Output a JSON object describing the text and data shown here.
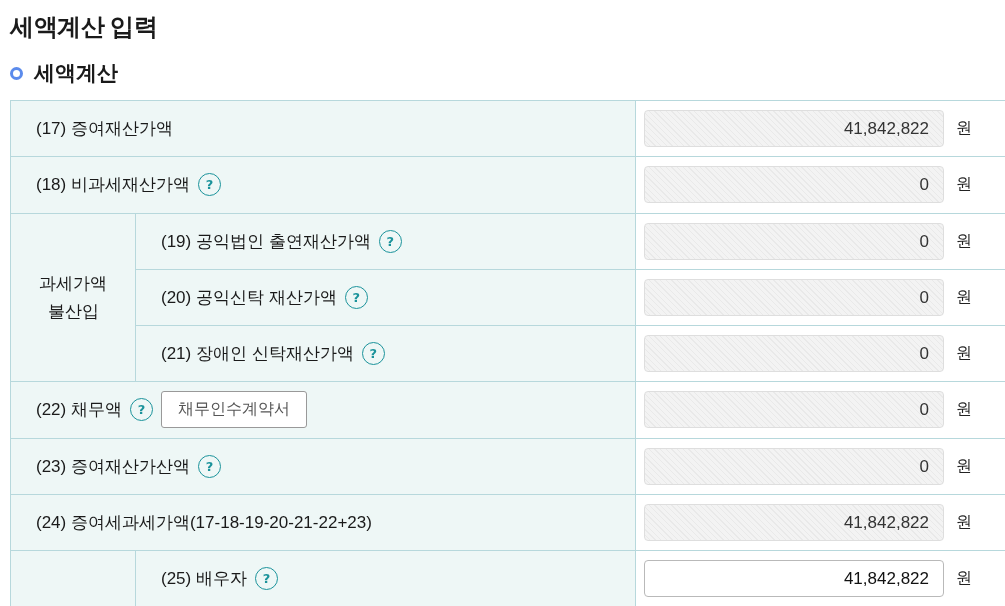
{
  "page_title": "세액계산 입력",
  "section": {
    "title": "세액계산"
  },
  "rows": [
    {
      "kind": "single",
      "label": "(17) 증여재산가액",
      "value": "41,842,822",
      "unit": "원",
      "editable": false
    },
    {
      "kind": "single",
      "label": "(18) 비과세재산가액",
      "help": "?",
      "value": "0",
      "unit": "원",
      "editable": false
    },
    {
      "kind": "group",
      "group_label": "과세가액 불산입",
      "children": [
        {
          "label": "(19) 공익법인 출연재산가액",
          "help": "?",
          "value": "0",
          "unit": "원",
          "editable": false
        },
        {
          "label": "(20) 공익신탁 재산가액",
          "help": "?",
          "value": "0",
          "unit": "원",
          "editable": false
        },
        {
          "label": "(21) 장애인 신탁재산가액",
          "help": "?",
          "value": "0",
          "unit": "원",
          "editable": false
        }
      ]
    },
    {
      "kind": "single",
      "label": "(22) 채무액",
      "help": "?",
      "button": "채무인수계약서",
      "value": "0",
      "unit": "원",
      "editable": false
    },
    {
      "kind": "single",
      "label": "(23) 증여재산가산액",
      "help": "?",
      "value": "0",
      "unit": "원",
      "editable": false
    },
    {
      "kind": "single",
      "label": "(24) 증여세과세가액(17-18-19-20-21-22+23)",
      "value": "41,842,822",
      "unit": "원",
      "editable": false
    },
    {
      "kind": "group",
      "children": [
        {
          "label": "(25) 배우자",
          "help": "?",
          "value": "41,842,822",
          "unit": "원",
          "editable": true
        }
      ]
    }
  ]
}
